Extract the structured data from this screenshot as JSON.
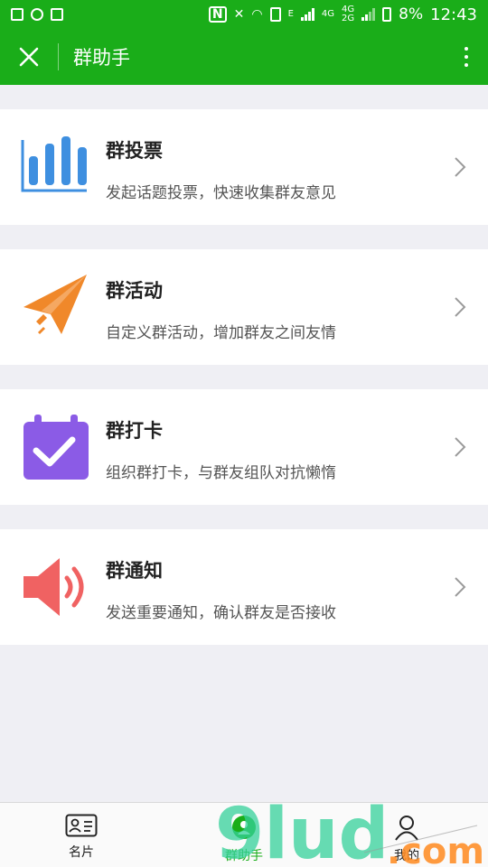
{
  "status_bar": {
    "time": "12:43",
    "battery_percent": "8%",
    "network_small_1": "4G",
    "network_small_2": "4G",
    "network_small_3": "2G",
    "network_e": "E"
  },
  "header": {
    "title": "群助手",
    "close_icon": "close-icon",
    "more_icon": "more-vertical-icon"
  },
  "items": [
    {
      "title": "群投票",
      "desc": "发起话题投票，快速收集群友意见",
      "icon": "bar-chart-icon",
      "color": "#3e8fe0"
    },
    {
      "title": "群活动",
      "desc": "自定义群活动，增加群友之间友情",
      "icon": "paper-plane-icon",
      "color": "#f0882a"
    },
    {
      "title": "群打卡",
      "desc": "组织群打卡，与群友组队对抗懒惰",
      "icon": "calendar-check-icon",
      "color": "#8b5be6"
    },
    {
      "title": "群通知",
      "desc": "发送重要通知，确认群友是否接收",
      "icon": "speaker-icon",
      "color": "#f06262"
    }
  ],
  "bottom_nav": [
    {
      "label": "名片",
      "icon": "card-icon"
    },
    {
      "label": "群助手",
      "icon": "helper-icon"
    },
    {
      "label": "我的",
      "icon": "person-icon"
    }
  ],
  "colors": {
    "brand_green": "#1aad19",
    "background": "#efeff4"
  }
}
